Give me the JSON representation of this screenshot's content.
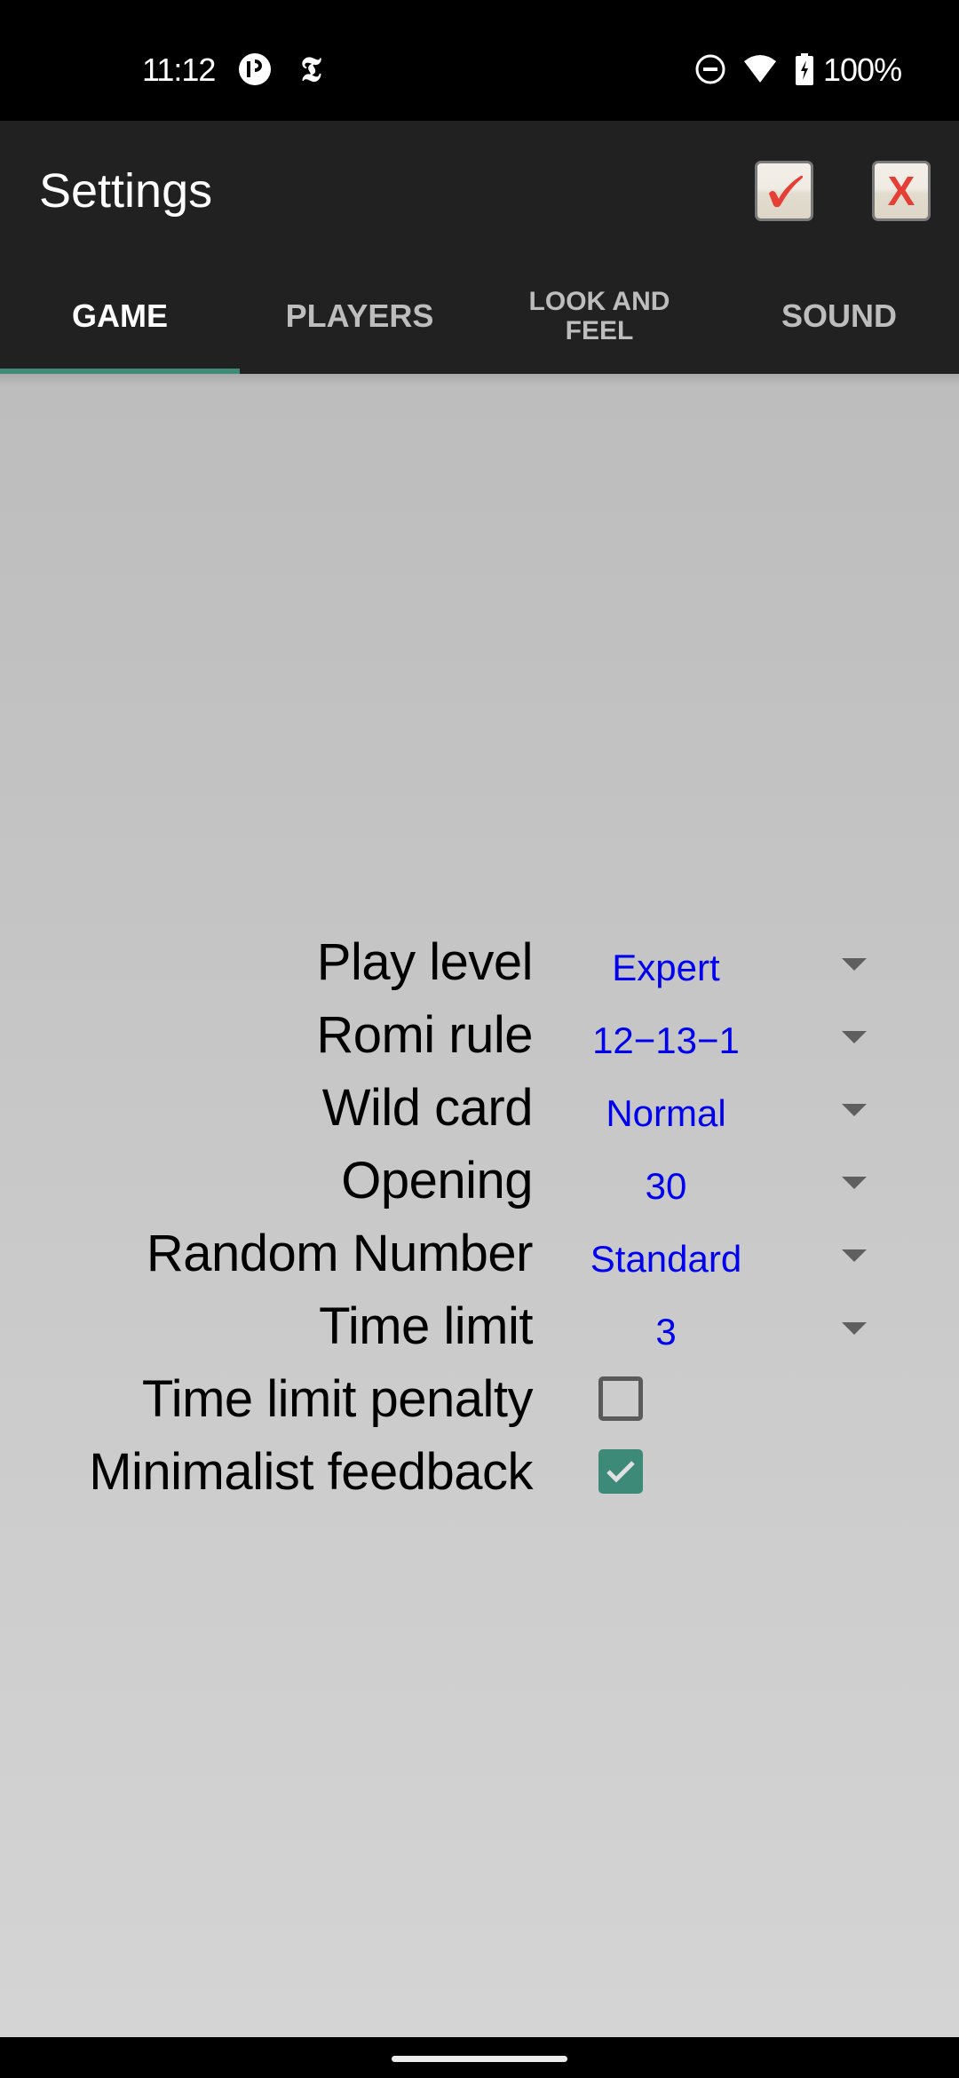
{
  "status_bar": {
    "time": "11:12",
    "battery_percent": "100%",
    "icons": [
      "notification-app-icon",
      "nyt-icon",
      "do-not-disturb-icon",
      "wifi-icon",
      "battery-charging-icon"
    ]
  },
  "app_bar": {
    "title": "Settings",
    "ok_icon": "✔",
    "cancel_label": "X",
    "accent_color": "#e53e34"
  },
  "tabs": [
    {
      "label": "GAME",
      "active": true
    },
    {
      "label": "PLAYERS",
      "active": false
    },
    {
      "label": "LOOK AND FEEL",
      "active": false
    },
    {
      "label": "SOUND",
      "active": false
    }
  ],
  "tab_indicator_color": "#3d8a78",
  "settings": {
    "play_level": {
      "label": "Play level",
      "value": "Expert"
    },
    "romi_rule": {
      "label": "Romi rule",
      "value": "12−13−1"
    },
    "wild_card": {
      "label": "Wild card",
      "value": "Normal"
    },
    "opening": {
      "label": "Opening",
      "value": "30"
    },
    "random_number": {
      "label": "Random Number",
      "value": "Standard"
    },
    "time_limit": {
      "label": "Time limit",
      "value": "3"
    },
    "time_limit_penalty": {
      "label": "Time limit penalty",
      "checked": false
    },
    "minimalist_feedback": {
      "label": "Minimalist feedback",
      "checked": true
    }
  },
  "colors": {
    "spinner_value": "#0000ee",
    "checkbox_checked": "#3d8a78"
  }
}
